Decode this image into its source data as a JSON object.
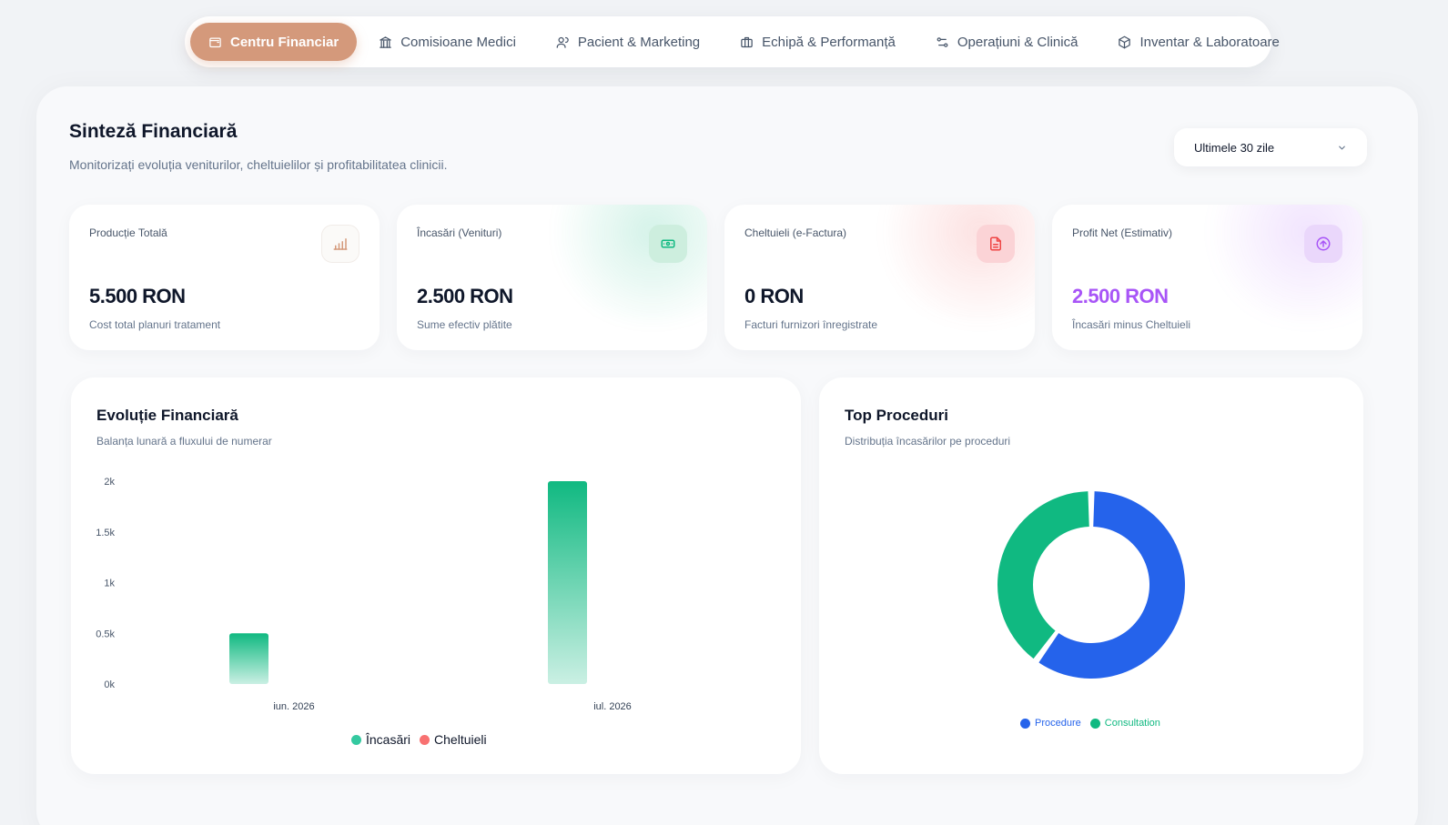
{
  "nav": {
    "tabs": [
      {
        "label": "Centru Financiar",
        "icon": "wallet-icon",
        "active": true
      },
      {
        "label": "Comisioane Medici",
        "icon": "bank-icon",
        "active": false
      },
      {
        "label": "Pacient & Marketing",
        "icon": "users-icon",
        "active": false
      },
      {
        "label": "Echipă & Performanță",
        "icon": "briefcase-icon",
        "active": false
      },
      {
        "label": "Operațiuni & Clinică",
        "icon": "workflow-icon",
        "active": false
      },
      {
        "label": "Inventar & Laboratoare",
        "icon": "package-icon",
        "active": false
      }
    ]
  },
  "header": {
    "title": "Sinteză Financiară",
    "subtitle": "Monitorizați evoluția veniturilor, cheltuielilor și profitabilitatea clinicii.",
    "range_select": "Ultimele 30 zile"
  },
  "kpis": [
    {
      "label": "Producție Totală",
      "value": "5.500 RON",
      "note": "Cost total planuri tratament",
      "icon": "bar-chart-icon",
      "accent": "#d4997b",
      "value_color": "#0f172a"
    },
    {
      "label": "Încasări (Venituri)",
      "value": "2.500 RON",
      "note": "Sume efectiv plătite",
      "icon": "banknote-icon",
      "accent": "#10b981",
      "value_color": "#0f172a"
    },
    {
      "label": "Cheltuieli (e-Factura)",
      "value": "0 RON",
      "note": "Facturi furnizori înregistrate",
      "icon": "file-text-icon",
      "accent": "#ef4444",
      "value_color": "#0f172a"
    },
    {
      "label": "Profit Net (Estimativ)",
      "value": "2.500 RON",
      "note": "Încasări minus Cheltuieli",
      "icon": "arrow-up-circle-icon",
      "accent": "#a855f7",
      "value_color": "#a855f7"
    }
  ],
  "evolution": {
    "title": "Evoluție Financiară",
    "subtitle": "Balanța lunară a fluxului de numerar"
  },
  "procedures": {
    "title": "Top Proceduri",
    "subtitle": "Distribuția încasărilor pe proceduri"
  },
  "chart_data": [
    {
      "type": "bar",
      "categories": [
        "iun. 2026",
        "iul. 2026"
      ],
      "series": [
        {
          "name": "Încasări",
          "values": [
            500,
            2000
          ],
          "color": "#10b981"
        },
        {
          "name": "Cheltuieli",
          "values": [
            0,
            0
          ],
          "color": "#f87171"
        }
      ],
      "yticks": [
        "0k",
        "0.5k",
        "1k",
        "1.5k",
        "2k"
      ],
      "ylim": [
        0,
        2000
      ],
      "legend": "bottom-center",
      "grid": false
    },
    {
      "type": "pie",
      "categories": [
        "Procedure",
        "Consultation"
      ],
      "values": [
        60,
        40
      ],
      "colors": [
        "#2563eb",
        "#10b981"
      ],
      "legend": "bottom-center"
    }
  ]
}
